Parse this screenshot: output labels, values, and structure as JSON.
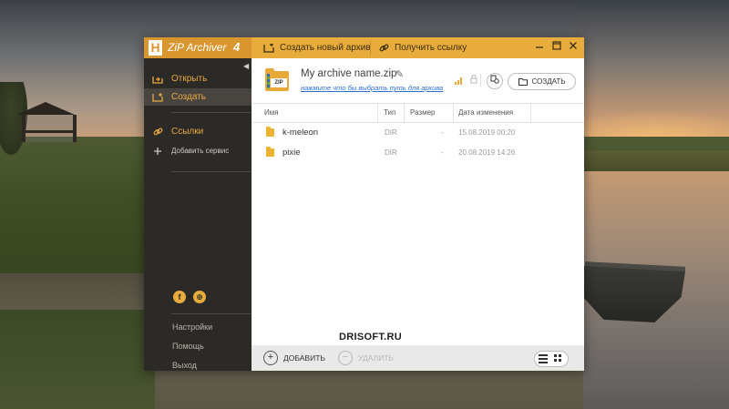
{
  "app": {
    "logo_letter": "H",
    "name": "ZiP Archiver",
    "version": "4"
  },
  "titlebar": {
    "new_archive_label": "Создать новый архив",
    "get_link_label": "Получить ссылку"
  },
  "sidebar": {
    "items": [
      {
        "label": "Открыть",
        "icon": "open-icon"
      },
      {
        "label": "Создать",
        "icon": "create-icon",
        "active": true
      },
      {
        "label": "Ссылки",
        "icon": "link-icon"
      },
      {
        "label": "Добавить сервис",
        "icon": "plus-icon"
      }
    ],
    "social": [
      {
        "icon": "facebook-icon",
        "glyph": "f"
      },
      {
        "icon": "web-icon",
        "glyph": "⊕"
      }
    ],
    "bottom": [
      "Настройки",
      "Помощь",
      "Выход"
    ]
  },
  "archive": {
    "name": "My archive name.zip",
    "path_hint": "нажмите что бы выбрать путь для архива",
    "icon_label": "ZIP",
    "create_label": "СОЗДАТЬ"
  },
  "table": {
    "headers": {
      "name": "Имя",
      "type": "Тип",
      "size": "Размер",
      "date": "Дата изменения"
    },
    "rows": [
      {
        "name": "k-meleon",
        "type": "DIR",
        "size": "-",
        "date": "15.08.2019 00:20"
      },
      {
        "name": "pixie",
        "type": "DIR",
        "size": "-",
        "date": "20.08.2019 14:26"
      }
    ]
  },
  "bottom_bar": {
    "add_label": "ДОБАВИТЬ",
    "remove_label": "УДАЛИТЬ"
  },
  "watermark": "DRISOFT.RU",
  "colors": {
    "accent": "#e8ac3c",
    "sidebar_bg": "#2c2a27",
    "link": "#2f6fd0"
  }
}
